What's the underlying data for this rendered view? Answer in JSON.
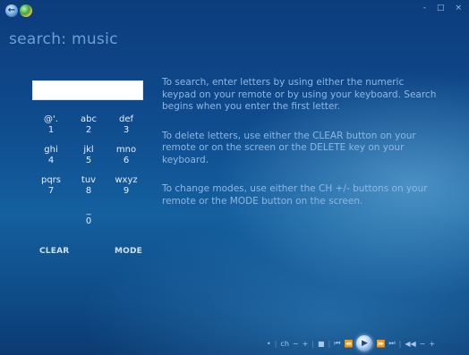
{
  "header": {
    "title": "search: music",
    "back_icon": "←",
    "window_buttons": [
      "-",
      "□",
      "×"
    ]
  },
  "search": {
    "value": "",
    "placeholder": ""
  },
  "keypad": {
    "keys": [
      {
        "letters": "@'.",
        "digit": "1"
      },
      {
        "letters": "abc",
        "digit": "2"
      },
      {
        "letters": "def",
        "digit": "3"
      },
      {
        "letters": "ghi",
        "digit": "4"
      },
      {
        "letters": "jkl",
        "digit": "5"
      },
      {
        "letters": "mno",
        "digit": "6"
      },
      {
        "letters": "pqrs",
        "digit": "7"
      },
      {
        "letters": "tuv",
        "digit": "8"
      },
      {
        "letters": "wxyz",
        "digit": "9"
      },
      {
        "letters": "_",
        "digit": "0"
      }
    ],
    "clear_label": "CLEAR",
    "mode_label": "MODE"
  },
  "instructions": [
    "To search, enter letters by using either the numeric keypad on your remote or by using your keyboard. Search begins when you enter the first letter.",
    "To delete letters, use either the CLEAR button on your remote or on the screen or the DELETE key on your keyboard.",
    "To change modes, use either the CH +/- buttons on your remote or the MODE button on the screen."
  ],
  "transport": {
    "items": [
      "•",
      "ch",
      "−",
      "+",
      "■",
      "⏮",
      "⏪",
      "▶",
      "⏩",
      "⏭",
      "◀◀",
      "−",
      "+"
    ],
    "sep": "|"
  }
}
